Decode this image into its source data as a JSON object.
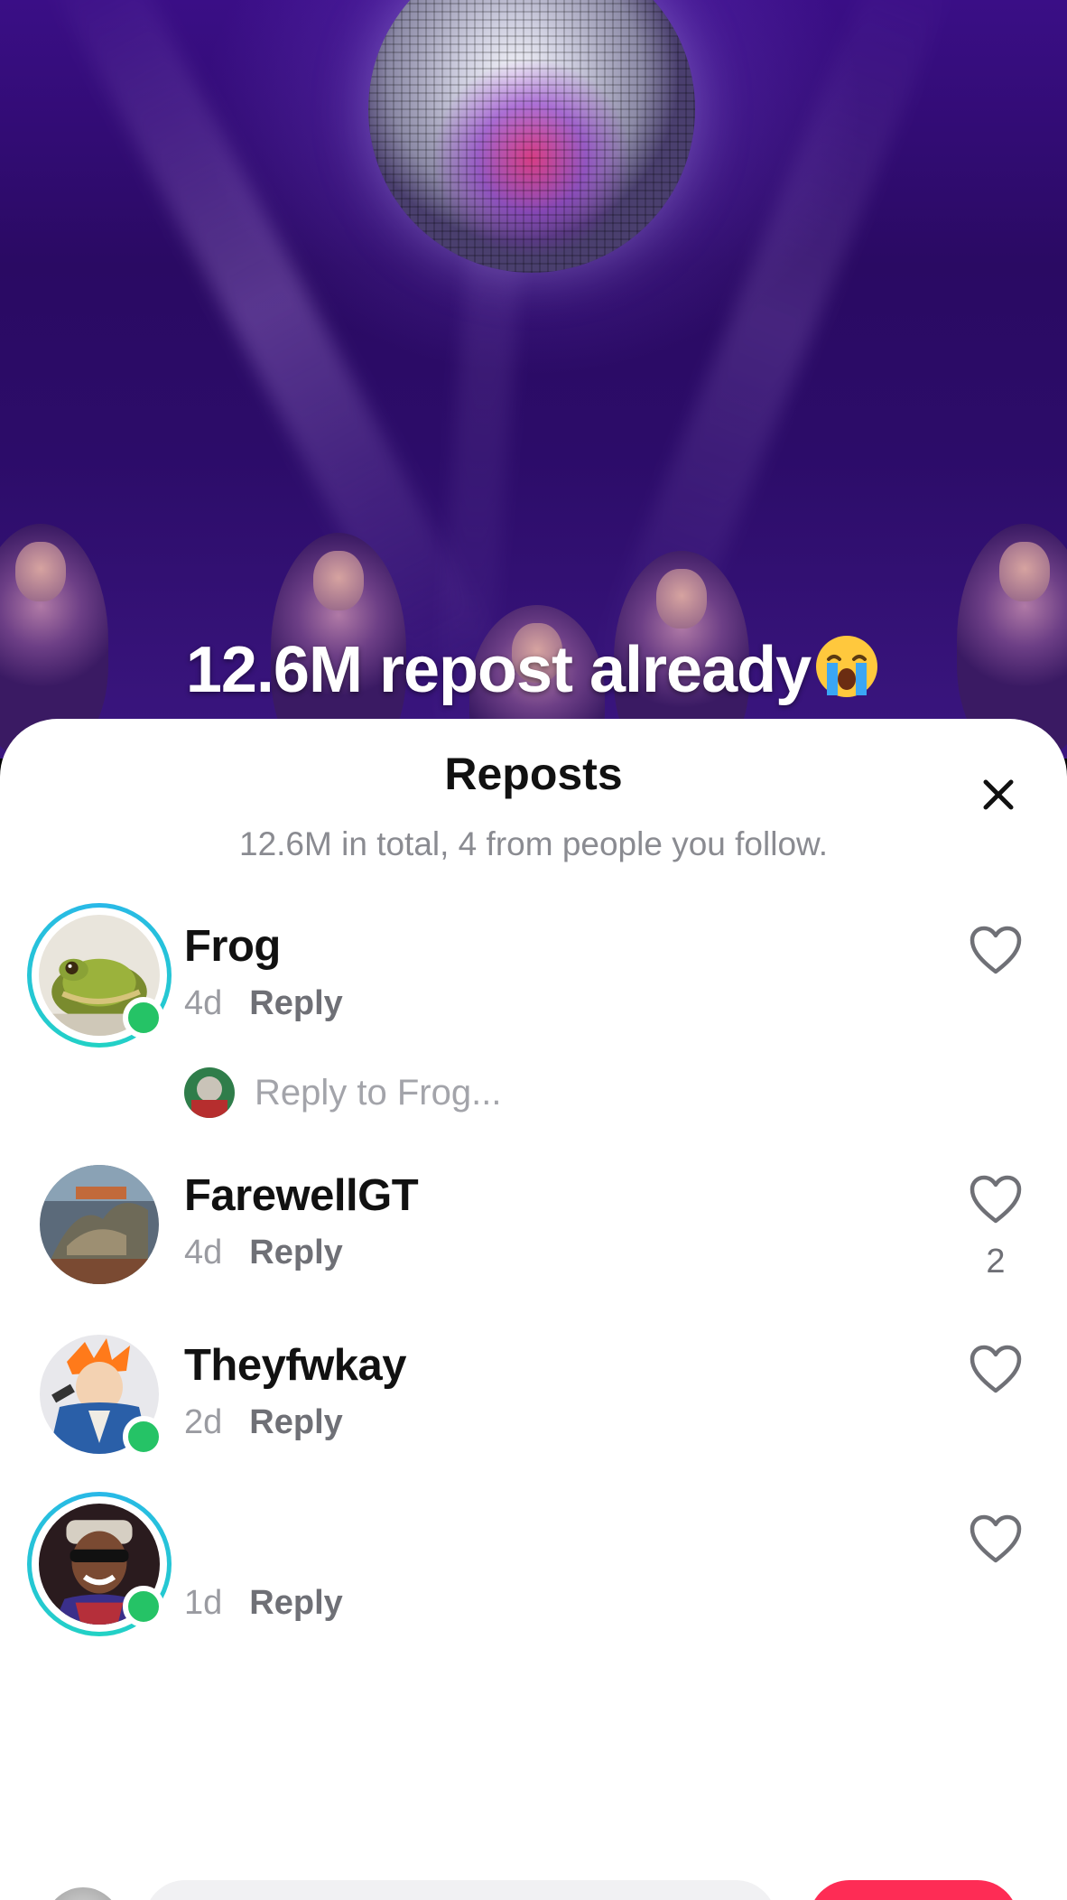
{
  "video": {
    "caption": "12.6M repost already",
    "caption_emoji": "loudly-crying-face-emoji"
  },
  "sheet": {
    "title": "Reposts",
    "subtitle": "12.6M in total, 4 from people you follow.",
    "close_icon": "close-icon"
  },
  "reposts": [
    {
      "username": "Frog",
      "time": "4d",
      "reply_label": "Reply",
      "has_story_ring": true,
      "online": true,
      "likes": "",
      "avatar": "frog-avatar"
    },
    {
      "username": "FarewellGT",
      "time": "4d",
      "reply_label": "Reply",
      "has_story_ring": false,
      "online": false,
      "likes": "2",
      "avatar": "dinosaur-avatar"
    },
    {
      "username": "Theyfwkay",
      "time": "2d",
      "reply_label": "Reply",
      "has_story_ring": false,
      "online": true,
      "likes": "",
      "avatar": "anime-avatar"
    },
    {
      "username": "",
      "time": "1d",
      "reply_label": "Reply",
      "has_story_ring": true,
      "online": true,
      "likes": "",
      "avatar": "person-avatar"
    }
  ],
  "reply_to": {
    "placeholder": "Reply to Frog..."
  },
  "colors": {
    "online": "#25c366",
    "story_ring": "#29b8e8",
    "accent": "#fe2c55"
  }
}
